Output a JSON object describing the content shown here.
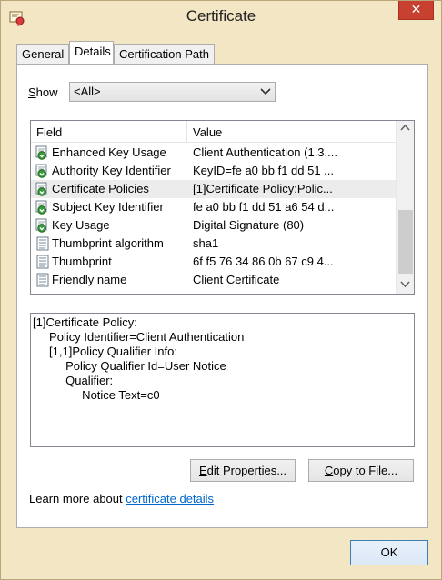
{
  "window": {
    "title": "Certificate",
    "close_symbol": "✕"
  },
  "tabs": [
    {
      "label": "General",
      "active": false
    },
    {
      "label": "Details",
      "active": true
    },
    {
      "label": "Certification Path",
      "active": false
    }
  ],
  "show": {
    "label_underlined": "S",
    "label_rest": "how",
    "selected": "<All>"
  },
  "list": {
    "columns": [
      "Field",
      "Value"
    ],
    "rows": [
      {
        "field": "Enhanced Key Usage",
        "value": "Client Authentication (1.3....",
        "icon": "extension-icon",
        "selected": false
      },
      {
        "field": "Authority Key Identifier",
        "value": "KeyID=fe a0 bb f1 dd 51 ...",
        "icon": "extension-icon",
        "selected": false
      },
      {
        "field": "Certificate Policies",
        "value": "[1]Certificate Policy:Polic...",
        "icon": "extension-icon",
        "selected": true
      },
      {
        "field": "Subject Key Identifier",
        "value": "fe a0 bb f1 dd 51 a6 54 d...",
        "icon": "extension-icon",
        "selected": false
      },
      {
        "field": "Key Usage",
        "value": "Digital Signature (80)",
        "icon": "extension-icon",
        "selected": false
      },
      {
        "field": "Thumbprint algorithm",
        "value": "sha1",
        "icon": "property-icon",
        "selected": false
      },
      {
        "field": "Thumbprint",
        "value": "6f f5 76 34 86 0b 67 c9 4...",
        "icon": "property-icon",
        "selected": false
      },
      {
        "field": "Friendly name",
        "value": "Client Certificate",
        "icon": "property-icon",
        "selected": false
      }
    ]
  },
  "detail": {
    "lines": [
      "[1]Certificate Policy:",
      "     Policy Identifier=Client Authentication",
      "     [1,1]Policy Qualifier Info:",
      "          Policy Qualifier Id=User Notice",
      "          Qualifier:",
      "               Notice Text=c0"
    ]
  },
  "buttons": {
    "edit_underlined": "E",
    "edit_rest": "dit Properties...",
    "copy_underlined": "C",
    "copy_rest": "opy to File...",
    "ok": "OK"
  },
  "learn_more": {
    "prefix": "Learn more about ",
    "link": "certificate details"
  },
  "colors": {
    "frame": "#f3e6c4",
    "close": "#c8402f",
    "link": "#0066cc",
    "scroll_thumb": "#cdcdcd"
  }
}
